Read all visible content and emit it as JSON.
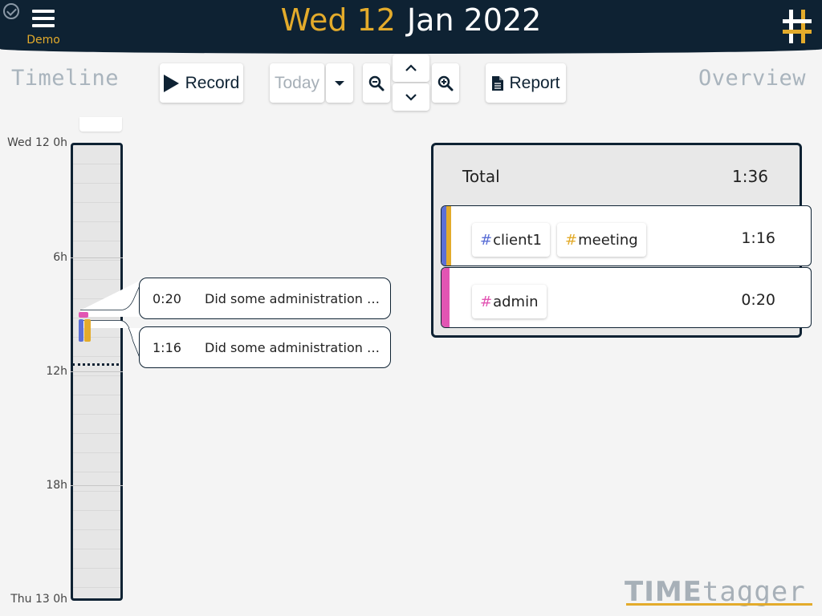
{
  "header": {
    "demo_label": "Demo",
    "date_day": "Wed 12",
    "date_rest": "Jan 2022"
  },
  "toolbar": {
    "timeline_title": "Timeline",
    "overview_title": "Overview",
    "record_label": "Record",
    "today_label": "Today",
    "report_label": "Report"
  },
  "timeline": {
    "labels": [
      "Wed 12 0h",
      "6h",
      "12h",
      "18h",
      "Thu 13 0h"
    ],
    "records": [
      {
        "duration": "0:20",
        "description": "Did some administration …"
      },
      {
        "duration": "1:16",
        "description": "Did some administration …"
      }
    ]
  },
  "overview": {
    "total_label": "Total",
    "total_value": "1:36",
    "rows": [
      {
        "duration": "1:16",
        "tags": [
          {
            "hash": "#",
            "name": "client1",
            "color": "#5b6fd6"
          },
          {
            "hash": "#",
            "name": "meeting",
            "color": "#e3ab2b"
          }
        ]
      },
      {
        "duration": "0:20",
        "tags": [
          {
            "hash": "#",
            "name": "admin",
            "color": "#e255b3"
          }
        ]
      }
    ]
  },
  "brand": {
    "time": "TIME",
    "tagger": "tagger"
  },
  "colors": {
    "header_bg": "#0e2233",
    "accent": "#e3ab2b",
    "tag_client1": "#5b6fd6",
    "tag_meeting": "#e3ab2b",
    "tag_admin": "#e255b3"
  }
}
